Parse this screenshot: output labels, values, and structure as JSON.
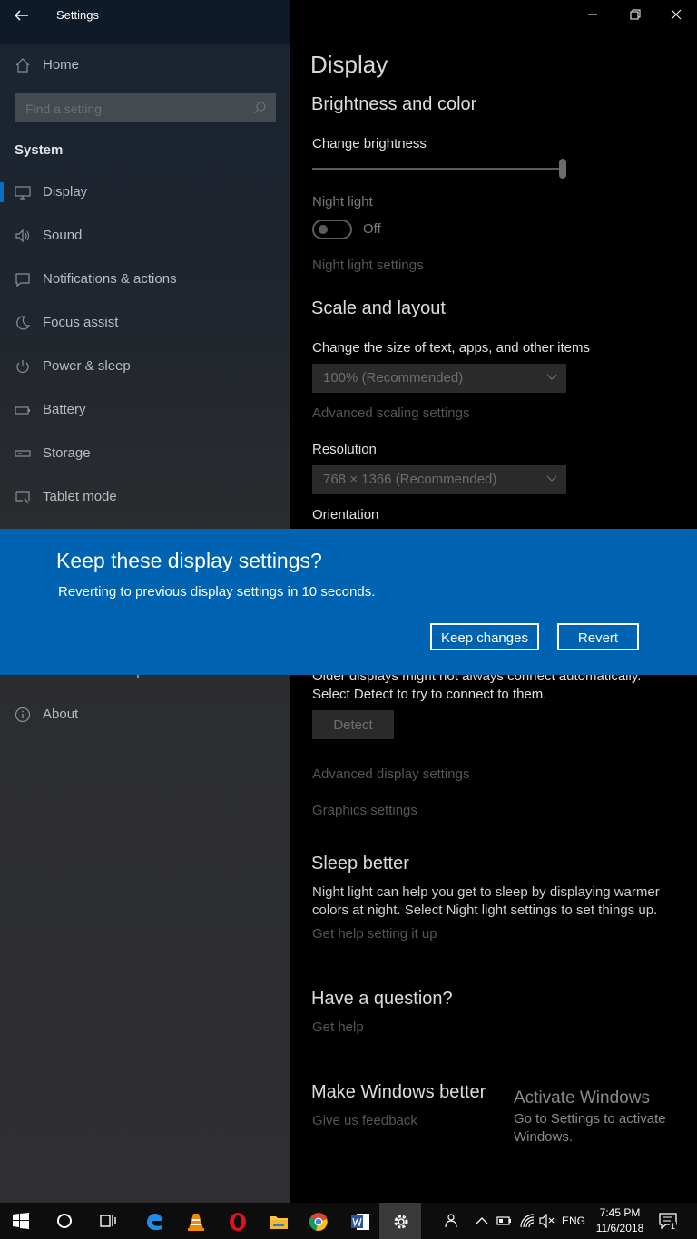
{
  "window": {
    "title": "Settings"
  },
  "sidebar": {
    "home": "Home",
    "search_placeholder": "Find a setting",
    "section": "System",
    "items": [
      {
        "label": "Display"
      },
      {
        "label": "Sound"
      },
      {
        "label": "Notifications & actions"
      },
      {
        "label": "Focus assist"
      },
      {
        "label": "Power & sleep"
      },
      {
        "label": "Battery"
      },
      {
        "label": "Storage"
      },
      {
        "label": "Tablet mode"
      },
      {
        "label": "Remote Desktop"
      },
      {
        "label": "About"
      }
    ]
  },
  "main": {
    "title": "Display",
    "brightness": {
      "heading": "Brightness and color",
      "change_brightness": "Change brightness",
      "brightness_level": 1.0,
      "night_light": "Night light",
      "night_light_state": "Off",
      "night_light_settings": "Night light settings"
    },
    "scale": {
      "heading": "Scale and layout",
      "size_label": "Change the size of text, apps, and other items",
      "size_value": "100% (Recommended)",
      "advanced_scaling": "Advanced scaling settings",
      "resolution_label": "Resolution",
      "resolution_value": "768 × 1366 (Recommended)",
      "orientation_label": "Orientation"
    },
    "multiple": {
      "line1": "Older displays might not always connect automatically.",
      "line2": "Select Detect to try to connect to them.",
      "detect": "Detect",
      "advanced_display": "Advanced display settings",
      "graphics": "Graphics settings"
    },
    "sleep": {
      "heading": "Sleep better",
      "line1": "Night light can help you get to sleep by displaying warmer",
      "line2": "colors at night. Select Night light settings to set things up.",
      "link": "Get help setting it up"
    },
    "question": {
      "heading": "Have a question?",
      "link": "Get help"
    },
    "better": {
      "heading": "Make Windows better",
      "link": "Give us feedback"
    },
    "watermark": {
      "line1": "Activate Windows",
      "line2": "Go to Settings to activate",
      "line3": "Windows."
    }
  },
  "dialog": {
    "title": "Keep these display settings?",
    "message": "Reverting to previous display settings in 10 seconds.",
    "keep": "Keep changes",
    "revert": "Revert"
  },
  "taskbar": {
    "lang": "ENG",
    "time": "7:45 PM",
    "date": "11/6/2018",
    "notifications": "1"
  },
  "colors": {
    "accent": "#0063b1",
    "sidebar_bg": "#2f2f31",
    "main_bg": "#000000"
  }
}
